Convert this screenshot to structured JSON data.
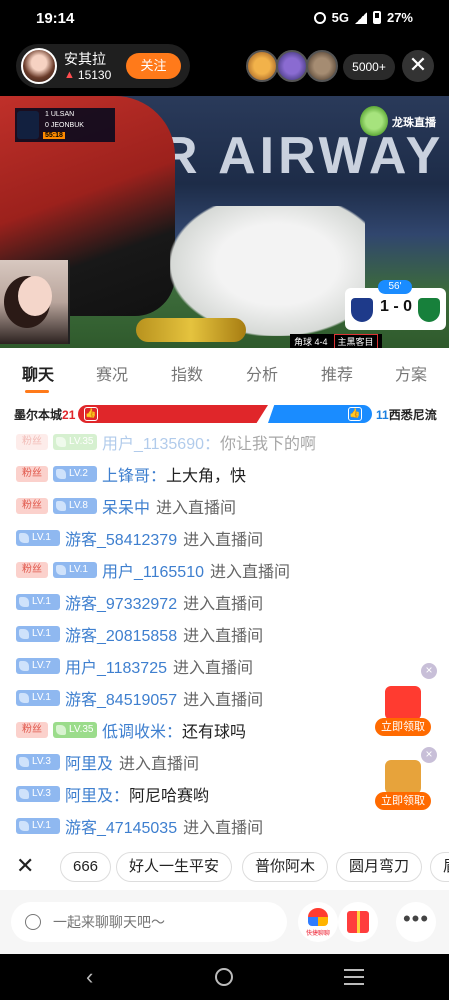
{
  "status_bar": {
    "time": "19:14",
    "network": "5G",
    "battery": "27%"
  },
  "host": {
    "name": "安其拉",
    "heat": "15130",
    "follow_label": "关注"
  },
  "viewers": {
    "count_label": "5000+"
  },
  "video": {
    "ad_text": "R AIRWAY",
    "brand_text": "龙珠直播",
    "scoreboard": {
      "home_abbr": "ULSAN",
      "home_score": "1",
      "away_abbr": "JEONBUK",
      "away_score": "0",
      "clock": "55:18"
    },
    "score_widget": {
      "minute": "56'",
      "score": "1 - 0"
    },
    "ticker": {
      "corner": "角球 4-4",
      "camera": "主黑客目"
    }
  },
  "tabs": [
    {
      "label": "聊天",
      "active": true
    },
    {
      "label": "赛况"
    },
    {
      "label": "指数"
    },
    {
      "label": "分析"
    },
    {
      "label": "推荐"
    },
    {
      "label": "方案"
    }
  ],
  "support": {
    "home_name": "墨尔本城",
    "home_count": "21",
    "away_count": "11",
    "away_name": "西悉尼流",
    "home_color": "#e0262a",
    "away_color": "#1a8cff"
  },
  "chat": [
    {
      "fan": "粉丝",
      "level": "LV.35",
      "user": "用户_1135690：",
      "text": "你让我下的啊"
    },
    {
      "fan": "粉丝",
      "level": "LV.2",
      "user": "上锋哥：",
      "text": "上大角，快"
    },
    {
      "fan": "粉丝",
      "level": "LV.8",
      "user": "呆呆中",
      "text": "进入直播间"
    },
    {
      "level": "LV.1",
      "user": "游客_58412379",
      "text": "进入直播间"
    },
    {
      "fan": "粉丝",
      "level": "LV.1",
      "user": "用户_1165510",
      "text": "进入直播间"
    },
    {
      "level": "LV.1",
      "user": "游客_97332972",
      "text": "进入直播间"
    },
    {
      "level": "LV.1",
      "user": "游客_20815858",
      "text": "进入直播间"
    },
    {
      "level": "LV.7",
      "user": "用户_1183725",
      "text": "进入直播间"
    },
    {
      "level": "LV.1",
      "user": "游客_84519057",
      "text": "进入直播间"
    },
    {
      "fan": "粉丝",
      "level": "LV.35",
      "user": "低调收米：",
      "text": "还有球吗"
    },
    {
      "level": "LV.3",
      "user": "阿里及",
      "text": "进入直播间"
    },
    {
      "level": "LV.3",
      "user": "阿里及：",
      "text": "阿尼哈赛哟"
    },
    {
      "level": "LV.1",
      "user": "游客_47145035",
      "text": "进入直播间"
    }
  ],
  "promos": [
    {
      "claim_label": "立即领取",
      "color": "#ff3b30"
    },
    {
      "claim_label": "立即领取",
      "color": "#e7a33b"
    }
  ],
  "quick_phrases": [
    "666",
    "好人一生平安",
    "普你阿木",
    "圆月弯刀",
    "眉"
  ],
  "input": {
    "placeholder": "一起来聊聊天吧～"
  },
  "shortcut_label": "快捷聊聊"
}
